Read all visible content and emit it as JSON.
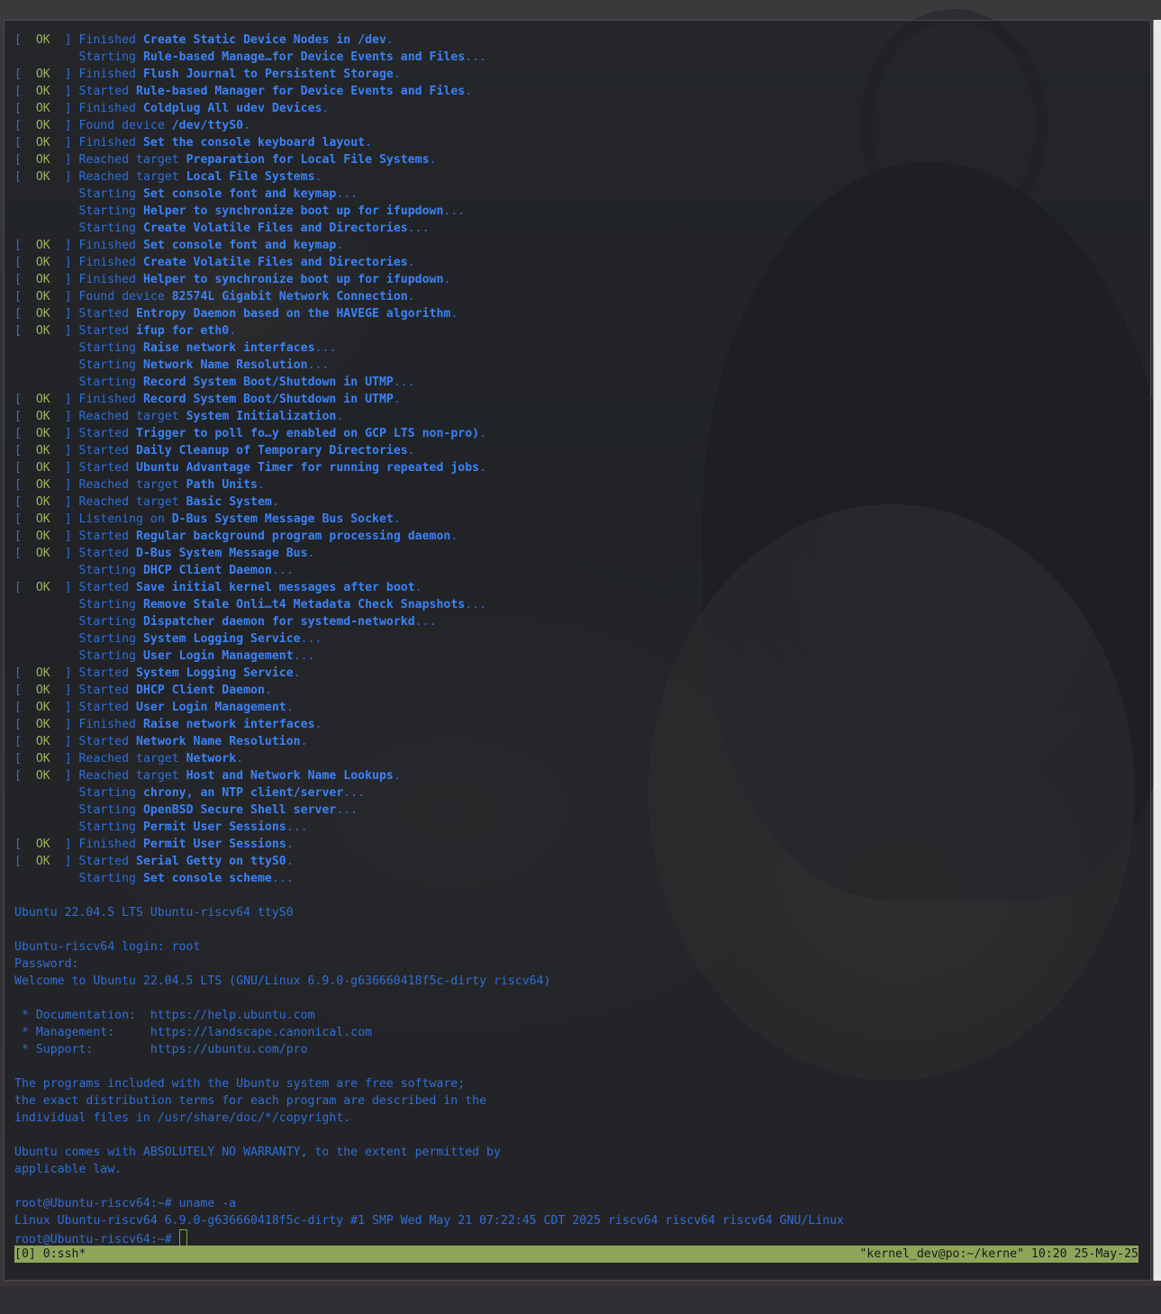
{
  "boot_log": [
    {
      "status": "OK",
      "verb": "Finished",
      "unit": "Create Static Device Nodes in /dev",
      "suffix": "."
    },
    {
      "status": "",
      "verb": "Starting",
      "unit": "Rule-based Manage…for Device Events and Files",
      "suffix": "..."
    },
    {
      "status": "OK",
      "verb": "Finished",
      "unit": "Flush Journal to Persistent Storage",
      "suffix": "."
    },
    {
      "status": "OK",
      "verb": "Started",
      "unit": "Rule-based Manager for Device Events and Files",
      "suffix": "."
    },
    {
      "status": "OK",
      "verb": "Finished",
      "unit": "Coldplug All udev Devices",
      "suffix": "."
    },
    {
      "status": "OK",
      "verb": "Found device",
      "unit": "/dev/ttyS0",
      "suffix": "."
    },
    {
      "status": "OK",
      "verb": "Finished",
      "unit": "Set the console keyboard layout",
      "suffix": "."
    },
    {
      "status": "OK",
      "verb": "Reached target",
      "unit": "Preparation for Local File Systems",
      "suffix": "."
    },
    {
      "status": "OK",
      "verb": "Reached target",
      "unit": "Local File Systems",
      "suffix": "."
    },
    {
      "status": "",
      "verb": "Starting",
      "unit": "Set console font and keymap",
      "suffix": "..."
    },
    {
      "status": "",
      "verb": "Starting",
      "unit": "Helper to synchronize boot up for ifupdown",
      "suffix": "..."
    },
    {
      "status": "",
      "verb": "Starting",
      "unit": "Create Volatile Files and Directories",
      "suffix": "..."
    },
    {
      "status": "OK",
      "verb": "Finished",
      "unit": "Set console font and keymap",
      "suffix": "."
    },
    {
      "status": "OK",
      "verb": "Finished",
      "unit": "Create Volatile Files and Directories",
      "suffix": "."
    },
    {
      "status": "OK",
      "verb": "Finished",
      "unit": "Helper to synchronize boot up for ifupdown",
      "suffix": "."
    },
    {
      "status": "OK",
      "verb": "Found device",
      "unit": "82574L Gigabit Network Connection",
      "suffix": "."
    },
    {
      "status": "OK",
      "verb": "Started",
      "unit": "Entropy Daemon based on the HAVEGE algorithm",
      "suffix": "."
    },
    {
      "status": "OK",
      "verb": "Started",
      "unit": "ifup for eth0",
      "suffix": "."
    },
    {
      "status": "",
      "verb": "Starting",
      "unit": "Raise network interfaces",
      "suffix": "..."
    },
    {
      "status": "",
      "verb": "Starting",
      "unit": "Network Name Resolution",
      "suffix": "..."
    },
    {
      "status": "",
      "verb": "Starting",
      "unit": "Record System Boot/Shutdown in UTMP",
      "suffix": "..."
    },
    {
      "status": "OK",
      "verb": "Finished",
      "unit": "Record System Boot/Shutdown in UTMP",
      "suffix": "."
    },
    {
      "status": "OK",
      "verb": "Reached target",
      "unit": "System Initialization",
      "suffix": "."
    },
    {
      "status": "OK",
      "verb": "Started",
      "unit": "Trigger to poll fo…y enabled on GCP LTS non-pro)",
      "suffix": "."
    },
    {
      "status": "OK",
      "verb": "Started",
      "unit": "Daily Cleanup of Temporary Directories",
      "suffix": "."
    },
    {
      "status": "OK",
      "verb": "Started",
      "unit": "Ubuntu Advantage Timer for running repeated jobs",
      "suffix": "."
    },
    {
      "status": "OK",
      "verb": "Reached target",
      "unit": "Path Units",
      "suffix": "."
    },
    {
      "status": "OK",
      "verb": "Reached target",
      "unit": "Basic System",
      "suffix": "."
    },
    {
      "status": "OK",
      "verb": "Listening on",
      "unit": "D-Bus System Message Bus Socket",
      "suffix": "."
    },
    {
      "status": "OK",
      "verb": "Started",
      "unit": "Regular background program processing daemon",
      "suffix": "."
    },
    {
      "status": "OK",
      "verb": "Started",
      "unit": "D-Bus System Message Bus",
      "suffix": "."
    },
    {
      "status": "",
      "verb": "Starting",
      "unit": "DHCP Client Daemon",
      "suffix": "..."
    },
    {
      "status": "OK",
      "verb": "Started",
      "unit": "Save initial kernel messages after boot",
      "suffix": "."
    },
    {
      "status": "",
      "verb": "Starting",
      "unit": "Remove Stale Onli…t4 Metadata Check Snapshots",
      "suffix": "..."
    },
    {
      "status": "",
      "verb": "Starting",
      "unit": "Dispatcher daemon for systemd-networkd",
      "suffix": "..."
    },
    {
      "status": "",
      "verb": "Starting",
      "unit": "System Logging Service",
      "suffix": "..."
    },
    {
      "status": "",
      "verb": "Starting",
      "unit": "User Login Management",
      "suffix": "..."
    },
    {
      "status": "OK",
      "verb": "Started",
      "unit": "System Logging Service",
      "suffix": "."
    },
    {
      "status": "OK",
      "verb": "Started",
      "unit": "DHCP Client Daemon",
      "suffix": "."
    },
    {
      "status": "OK",
      "verb": "Started",
      "unit": "User Login Management",
      "suffix": "."
    },
    {
      "status": "OK",
      "verb": "Finished",
      "unit": "Raise network interfaces",
      "suffix": "."
    },
    {
      "status": "OK",
      "verb": "Started",
      "unit": "Network Name Resolution",
      "suffix": "."
    },
    {
      "status": "OK",
      "verb": "Reached target",
      "unit": "Network",
      "suffix": "."
    },
    {
      "status": "OK",
      "verb": "Reached target",
      "unit": "Host and Network Name Lookups",
      "suffix": "."
    },
    {
      "status": "",
      "verb": "Starting",
      "unit": "chrony, an NTP client/server",
      "suffix": "..."
    },
    {
      "status": "",
      "verb": "Starting",
      "unit": "OpenBSD Secure Shell server",
      "suffix": "..."
    },
    {
      "status": "",
      "verb": "Starting",
      "unit": "Permit User Sessions",
      "suffix": "..."
    },
    {
      "status": "OK",
      "verb": "Finished",
      "unit": "Permit User Sessions",
      "suffix": "."
    },
    {
      "status": "OK",
      "verb": "Started",
      "unit": "Serial Getty on ttyS0",
      "suffix": "."
    },
    {
      "status": "",
      "verb": "Starting",
      "unit": "Set console scheme",
      "suffix": "..."
    }
  ],
  "console_lines": [
    "",
    "Ubuntu 22.04.5 LTS Ubuntu-riscv64 ttyS0",
    "",
    "Ubuntu-riscv64 login: root",
    "Password:",
    "Welcome to Ubuntu 22.04.5 LTS (GNU/Linux 6.9.0-g636660418f5c-dirty riscv64)",
    "",
    " * Documentation:  https://help.ubuntu.com",
    " * Management:     https://landscape.canonical.com",
    " * Support:        https://ubuntu.com/pro",
    "",
    "The programs included with the Ubuntu system are free software;",
    "the exact distribution terms for each program are described in the",
    "individual files in /usr/share/doc/*/copyright.",
    "",
    "Ubuntu comes with ABSOLUTELY NO WARRANTY, to the extent permitted by",
    "applicable law.",
    "",
    "root@Ubuntu-riscv64:~# uname -a",
    "Linux Ubuntu-riscv64 6.9.0-g636660418f5c-dirty #1 SMP Wed May 21 07:22:45 CDT 2025 riscv64 riscv64 riscv64 GNU/Linux"
  ],
  "prompt": "root@Ubuntu-riscv64:~# ",
  "status_bar": {
    "left": "[0] 0:ssh*",
    "right": "\"kernel_dev@po:~/kerne\" 10:20 25-May-25"
  },
  "colors": {
    "ok": "#9ab35e",
    "text": "#2f6fd8",
    "unit": "#3b82f6",
    "status_bar_bg": "#8ea55a"
  }
}
